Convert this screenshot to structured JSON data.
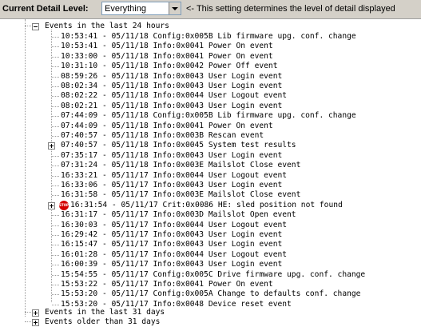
{
  "toolbar": {
    "label": "Current Detail Level:",
    "level_value": "Everything",
    "note": "<- This setting determines the level of detail displayed"
  },
  "tree": {
    "group_24h": "Events in the last 24 hours",
    "events": [
      "10:53:41 - 05/11/18 Config:0x005B Lib firmware upg. conf. change",
      "10:53:41 - 05/11/18 Info:0x0041 Power On event",
      "10:33:00 - 05/11/18 Info:0x0041 Power On event",
      "10:31:10 - 05/11/18 Info:0x0042 Power Off event",
      "08:59:26 - 05/11/18 Info:0x0043 User Login event",
      "08:02:34 - 05/11/18 Info:0x0043 User Login event",
      "08:02:22 - 05/11/18 Info:0x0044 User Logout event",
      "08:02:21 - 05/11/18 Info:0x0043 User Login event",
      "07:44:09 - 05/11/18 Config:0x005B Lib firmware upg. conf. change",
      "07:44:09 - 05/11/18 Info:0x0041 Power On event",
      "07:40:57 - 05/11/18 Info:0x003B Rescan event",
      "07:40:57 - 05/11/18 Info:0x0045 System test results",
      "07:35:17 - 05/11/18 Info:0x0043 User Login event",
      "07:31:24 - 05/11/18 Info:0x003E Mailslot Close event",
      "16:33:21 - 05/11/17 Info:0x0044 User Logout event",
      "16:33:06 - 05/11/17 Info:0x0043 User Login event",
      "16:31:58 - 05/11/17 Info:0x003E Mailslot Close event",
      "16:31:54 - 05/11/17 Crit:0x0086 HE: sled position not found",
      "16:31:17 - 05/11/17 Info:0x003D Mailslot Open event",
      "16:30:03 - 05/11/17 Info:0x0044 User Logout event",
      "16:29:42 - 05/11/17 Info:0x0043 User Login event",
      "16:15:47 - 05/11/17 Info:0x0043 User Login event",
      "16:01:28 - 05/11/17 Info:0x0044 User Logout event",
      "16:00:39 - 05/11/17 Info:0x0043 User Login event",
      "15:54:55 - 05/11/17 Config:0x005C Drive firmware upg. conf. change",
      "15:53:22 - 05/11/17 Info:0x0041 Power On event",
      "15:53:20 - 05/11/17 Config:0x005A Change to defaults conf. change",
      "15:53:20 - 05/11/17 Info:0x0048 Device reset event"
    ],
    "group_31d": "Events in the last 31 days",
    "group_older": "Events older than 31 days",
    "stop_badge": "STOP",
    "stop_color": "#d40000"
  }
}
